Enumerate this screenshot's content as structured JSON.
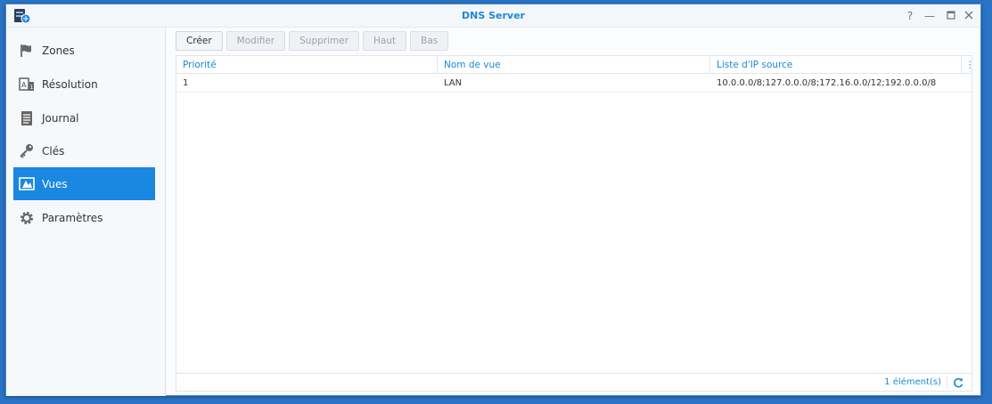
{
  "window": {
    "title": "DNS Server"
  },
  "sidebar": {
    "items": [
      {
        "label": "Zones",
        "icon": "flag-icon"
      },
      {
        "label": "Résolution",
        "icon": "resolution-icon"
      },
      {
        "label": "Journal",
        "icon": "log-icon"
      },
      {
        "label": "Clés",
        "icon": "key-icon"
      },
      {
        "label": "Vues",
        "icon": "views-icon",
        "active": true
      },
      {
        "label": "Paramètres",
        "icon": "gear-icon"
      }
    ]
  },
  "toolbar": {
    "create": "Créer",
    "edit": "Modifier",
    "delete": "Supprimer",
    "up": "Haut",
    "down": "Bas"
  },
  "table": {
    "columns": [
      "Priorité",
      "Nom de vue",
      "Liste d'IP source"
    ],
    "rows": [
      [
        "1",
        "LAN",
        "10.0.0.0/8;127.0.0.0/8;172.16.0.0/12;192.0.0.0/8"
      ]
    ]
  },
  "footer": {
    "count": "1 élément(s)"
  },
  "colors": {
    "accent": "#1a87e0",
    "link": "#1c88d6",
    "desktop": "#2b73c4"
  }
}
